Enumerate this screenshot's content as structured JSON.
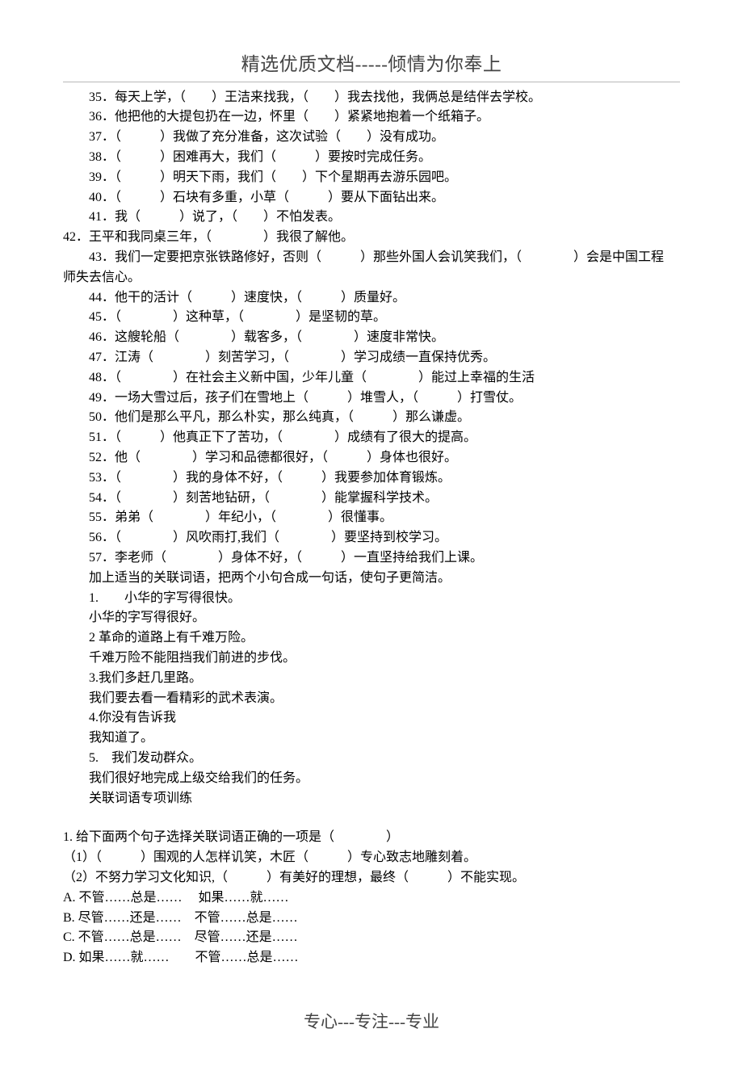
{
  "header": "精选优质文档-----倾情为你奉上",
  "footer": "专心---专注---专业",
  "lines": [
    {
      "cls": "indent2",
      "text": "35．每天上学，（　　）王洁来找我，（　　）我去找他，我俩总是结伴去学校。"
    },
    {
      "cls": "indent2",
      "text": "36．他把他的大提包扔在一边，怀里（　　）紧紧地抱着一个纸箱子。"
    },
    {
      "cls": "indent2",
      "text": "37．（　　　）我做了充分准备，这次试验（　　）没有成功。"
    },
    {
      "cls": "indent2",
      "text": "38．（　　　）困难再大，我们（　　　）要按时完成任务。"
    },
    {
      "cls": "indent2",
      "text": "39．（　　　）明天下雨，我们（　　）下个星期再去游乐园吧。"
    },
    {
      "cls": "indent2",
      "text": "40．（　　　）石块有多重，小草（　　　）要从下面钻出来。"
    },
    {
      "cls": "indent2",
      "text": "41．我（　　　）说了，（　　）不怕发表。"
    },
    {
      "cls": "indent0",
      "text": "42．王平和我同桌三年，（　　　　）我很了解他。"
    },
    {
      "cls": "indent2",
      "text": "43．我们一定要把京张铁路修好，否则（　　　）那些外国人会讥笑我们，（　　　　）会是中国工程"
    },
    {
      "cls": "indent0",
      "text": "师失去信心。"
    },
    {
      "cls": "indent2",
      "text": "44．他干的活计（　　　）速度快，（　　　）质量好。"
    },
    {
      "cls": "indent2",
      "text": "45．（　　　　）这种草，（　　　　）是坚韧的草。"
    },
    {
      "cls": "indent2",
      "text": "46．这艘轮船（　　　　）载客多，（　　　　）速度非常快。"
    },
    {
      "cls": "indent2",
      "text": "47．江涛（　　　　）刻苦学习，（　　　　）学习成绩一直保持优秀。"
    },
    {
      "cls": "indent2",
      "text": "48．（　　　　）在社会主义新中国，少年儿童（　　　　）能过上幸福的生活"
    },
    {
      "cls": "indent2",
      "text": "49．一场大雪过后，孩子们在雪地上（　　　）堆雪人，（　　　）打雪仗。"
    },
    {
      "cls": "indent2",
      "text": "50．他们是那么平凡，那么朴实，那么纯真，（　　　）那么谦虚。"
    },
    {
      "cls": "indent2",
      "text": "51．（　　　）他真正下了苦功，（　　　　）成绩有了很大的提高。"
    },
    {
      "cls": "indent2",
      "text": "52．他（　　　　）学习和品德都很好，（　　　）身体也很好。"
    },
    {
      "cls": "indent2",
      "text": "53．（　　　　）我的身体不好，（　　　）我要参加体育锻炼。"
    },
    {
      "cls": "indent2",
      "text": "54．（　　　　）刻苦地钻研，（　　　　）能掌握科学技术。"
    },
    {
      "cls": "indent2",
      "text": "55．弟弟（　　　　）年纪小，（　　　　）很懂事。"
    },
    {
      "cls": "indent2",
      "text": "56．（　　　　）风吹雨打,我们（　　　　）要坚持到校学习。"
    },
    {
      "cls": "indent2",
      "text": "57．李老师（　　　　）身体不好，（　　　）一直坚持给我们上课。"
    },
    {
      "cls": "indent2",
      "text": "加上适当的关联词语，把两个小句合成一句话，使句子更简洁。"
    },
    {
      "cls": "indent2",
      "text": "1.　　小华的字写得很快。"
    },
    {
      "cls": "indent2",
      "text": "小华的字写得很好。"
    },
    {
      "cls": "indent2",
      "text": "2 革命的道路上有千难万险。"
    },
    {
      "cls": "indent2",
      "text": "千难万险不能阻挡我们前进的步伐。"
    },
    {
      "cls": "indent2",
      "text": "3.我们多赶几里路。"
    },
    {
      "cls": "indent2",
      "text": "我们要去看一看精彩的武术表演。"
    },
    {
      "cls": "indent2",
      "text": "4.你没有告诉我"
    },
    {
      "cls": "indent2",
      "text": "我知道了。"
    },
    {
      "cls": "indent2",
      "text": "5.　我们发动群众。"
    },
    {
      "cls": "indent2",
      "text": "我们很好地完成上级交给我们的任务。"
    },
    {
      "cls": "indent2",
      "text": "关联词语专项训练"
    },
    {
      "cls": "gap",
      "text": ""
    },
    {
      "cls": "indent0",
      "text": "1. 给下面两个句子选择关联词语正确的一项是（　　　　）"
    },
    {
      "cls": "indent0",
      "text": "（1）（　　　）围观的人怎样讥笑，木匠（　　　）专心致志地雕刻着。"
    },
    {
      "cls": "indent0",
      "text": "（2）不努力学习文化知识,（　　　）有美好的理想，最终（　　　）不能实现。"
    },
    {
      "cls": "indent0",
      "text": "A. 不管……总是……　 如果……就……"
    },
    {
      "cls": "indent0",
      "text": "B. 尽管……还是……　不管……总是……"
    },
    {
      "cls": "indent0",
      "text": "C. 不管……总是……　尽管……还是……"
    },
    {
      "cls": "indent0",
      "text": "D. 如果……就……　　不管……总是……"
    }
  ]
}
